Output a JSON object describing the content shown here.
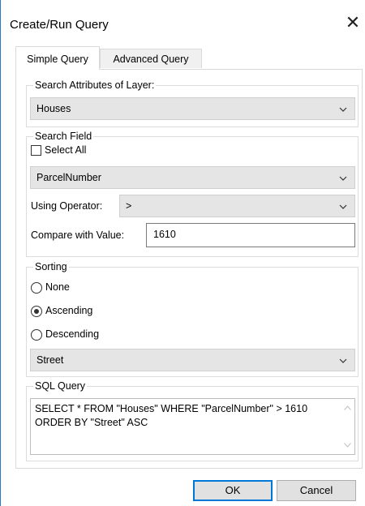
{
  "window": {
    "title": "Create/Run Query",
    "close_glyph": "✕"
  },
  "tabs": [
    {
      "label": "Simple Query",
      "active": true
    },
    {
      "label": "Advanced Query",
      "active": false
    }
  ],
  "search_attributes": {
    "group_label": "Search Attributes of Layer:",
    "layer_selected": "Houses"
  },
  "search_field": {
    "group_label": "Search Field",
    "select_all_label": "Select All",
    "select_all_checked": false,
    "field_selected": "ParcelNumber",
    "operator_label": "Using Operator:",
    "operator_selected": ">",
    "compare_label": "Compare with Value:",
    "compare_value": "1610"
  },
  "sorting": {
    "group_label": "Sorting",
    "options": [
      {
        "label": "None",
        "selected": false
      },
      {
        "label": "Ascending",
        "selected": true
      },
      {
        "label": "Descending",
        "selected": false
      }
    ],
    "sort_field_selected": "Street"
  },
  "sql_query": {
    "group_label": "SQL Query",
    "text": "SELECT * FROM \"Houses\" WHERE \"ParcelNumber\" > 1610 ORDER BY \"Street\" ASC"
  },
  "buttons": {
    "ok": "OK",
    "cancel": "Cancel"
  },
  "colors": {
    "accent": "#0078d7",
    "window_border": "#2b78c8",
    "combo_bg": "#e5e5e5"
  },
  "icons": {
    "close": "close-icon",
    "dropdown": "chevron-down-icon",
    "scroll_up": "scroll-up-arrow-icon",
    "scroll_down": "scroll-down-arrow-icon"
  }
}
